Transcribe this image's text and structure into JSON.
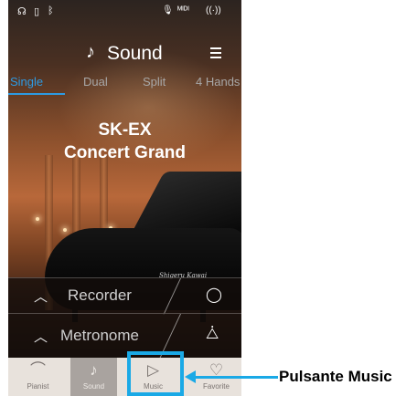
{
  "status_bar": {
    "icons": [
      "headphone-icon",
      "usb-memory-icon",
      "bluetooth-icon",
      "microphone-icon",
      "midi-icon",
      "wireless-icon"
    ],
    "glyphs": [
      "☊",
      "▯",
      "ᛒ",
      "🎙",
      "ᴹᴵᴰᴵ",
      "((·))"
    ]
  },
  "header": {
    "title": "Sound",
    "note_icon": "♪"
  },
  "tabs": [
    {
      "label": "Single",
      "active": true
    },
    {
      "label": "Dual",
      "active": false
    },
    {
      "label": "Split",
      "active": false
    },
    {
      "label": "4 Hands",
      "active": false
    }
  ],
  "sound": {
    "line1": "SK-EX",
    "line2": "Concert Grand"
  },
  "piano_logo": "Shigeru Kawai",
  "recorder_panel": {
    "caret": "︿",
    "label": "Recorder",
    "icon": "◯"
  },
  "metronome_panel": {
    "caret": "︿",
    "label": "Metronome",
    "icon": "⧊"
  },
  "nav": [
    {
      "label": "Pianist",
      "icon": "⌒"
    },
    {
      "label": "Sound",
      "icon": "♪"
    },
    {
      "label": "Music",
      "icon": "▷"
    },
    {
      "label": "Favorite",
      "icon": "♡"
    }
  ],
  "callout": {
    "label": "Pulsante Music"
  },
  "colors": {
    "accent": "#2d9be4",
    "highlight": "#1aa9e6"
  }
}
